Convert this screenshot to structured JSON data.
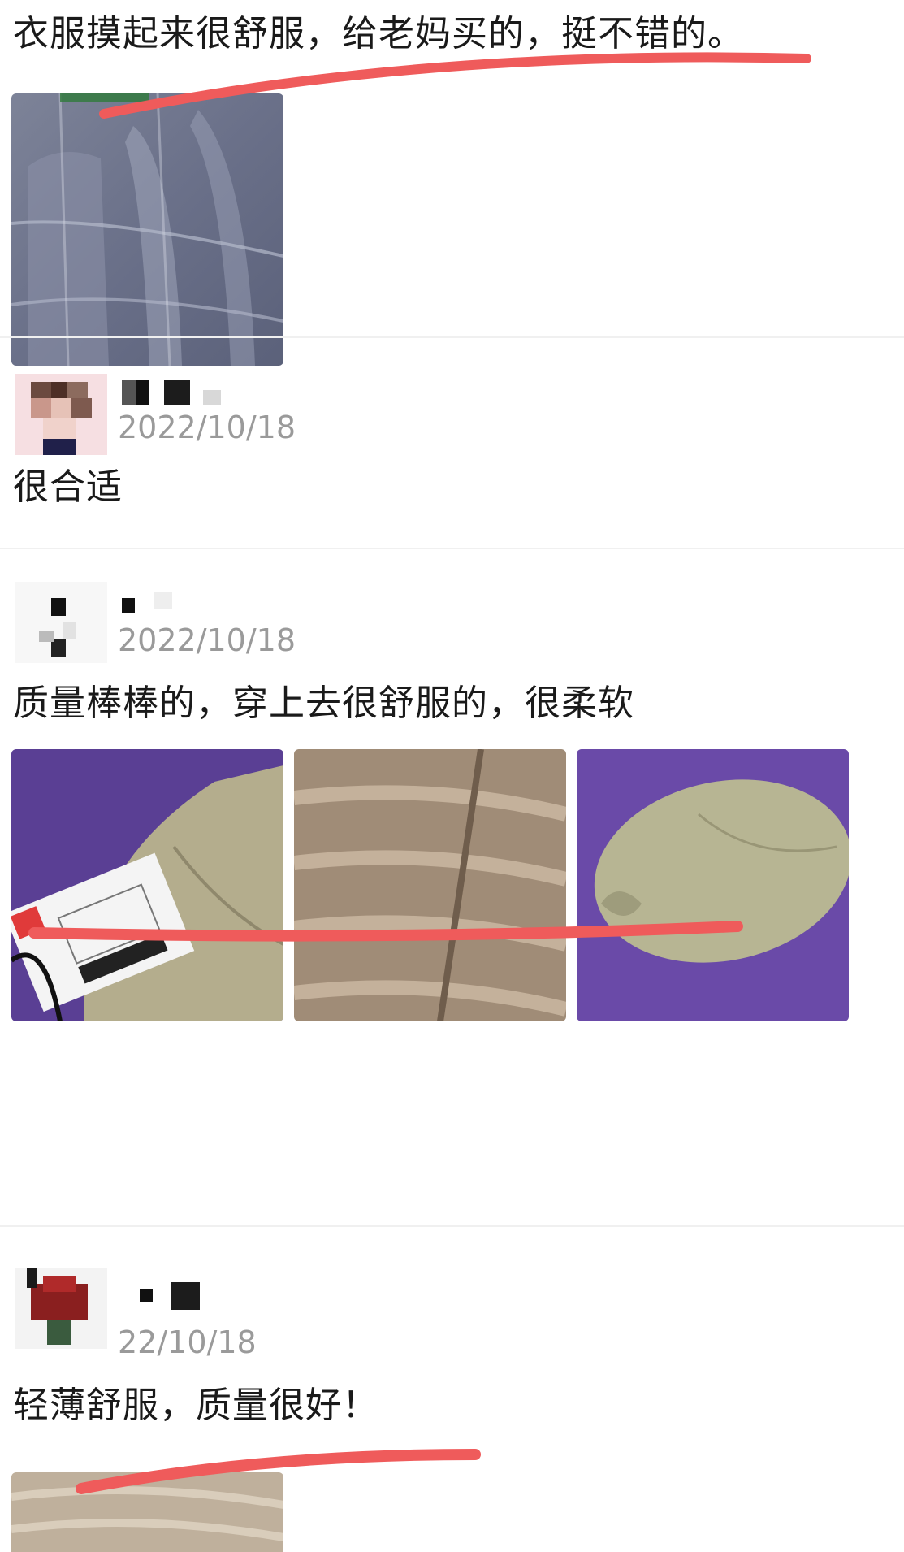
{
  "reviews": [
    {
      "text": "衣服摸起来很舒服，给老妈买的，挺不错的。"
    },
    {
      "date": "2022/10/18",
      "text": "很合适"
    },
    {
      "date": "2022/10/18",
      "text": "质量棒棒的，穿上去很舒服的，很柔软"
    },
    {
      "date": "22/10/18",
      "text": "轻薄舒服，质量很好！"
    }
  ],
  "colors": {
    "divider": "#f0f0f0",
    "date_text": "#9a9a9a",
    "highlight_stroke": "#ef5b5b",
    "purple_mat": "#6a4aa8"
  },
  "icons": {
    "avatars": [
      "pixelated-avatar",
      "pixelated-avatar",
      "pixelated-avatar"
    ],
    "usernames": [
      "pixelated-username",
      "pixelated-username",
      "pixelated-username"
    ]
  }
}
